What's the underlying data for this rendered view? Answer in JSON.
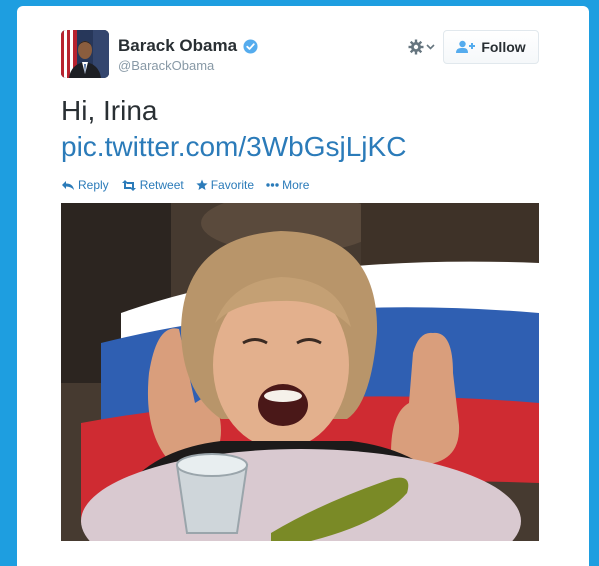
{
  "user": {
    "display_name": "Barack Obama",
    "handle": "@BarackObama",
    "verified": true
  },
  "header": {
    "follow_label": "Follow",
    "settings_icon": "gear-icon",
    "dropdown_icon": "chevron-down-icon",
    "follow_icon": "add-user-icon"
  },
  "tweet": {
    "text": "Hi, Irina",
    "link": "pic.twitter.com/3WbGsjLjKC"
  },
  "actions": {
    "reply": "Reply",
    "retweet": "Retweet",
    "favorite": "Favorite",
    "more": "More"
  },
  "colors": {
    "background": "#1e9ee0",
    "link": "#2b7bb9",
    "verified": "#55acee",
    "text": "#292f33",
    "muted": "#8899a6"
  }
}
